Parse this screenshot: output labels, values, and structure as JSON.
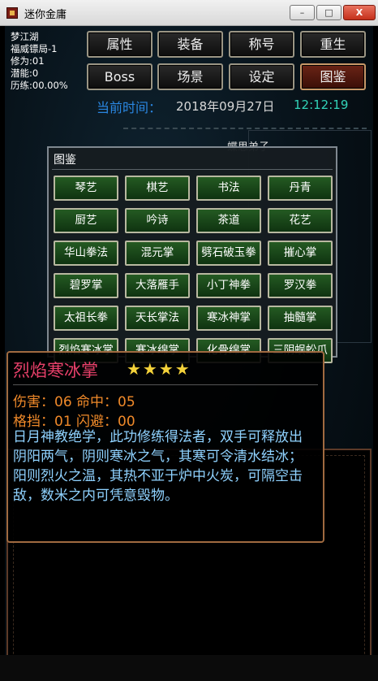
{
  "window": {
    "title": "迷你金庸",
    "min": "–",
    "max": "□",
    "close": "X"
  },
  "player": {
    "name": "梦江湖",
    "location": "福威镖局-1",
    "cultivation": "修为:01",
    "potential": "潜能:0",
    "experience": "历练:00.00%"
  },
  "menu": [
    "属性",
    "装备",
    "称号",
    "重生",
    "Boss",
    "场景",
    "设定",
    "图鉴"
  ],
  "time": {
    "label": "当前时间：",
    "date": "2018年09月27日",
    "clock": "12:12:19"
  },
  "background_text": "蝶思弟子",
  "atlas": {
    "title": "图鉴",
    "skills": [
      "琴艺",
      "棋艺",
      "书法",
      "丹青",
      "厨艺",
      "吟诗",
      "茶道",
      "花艺",
      "华山拳法",
      "混元掌",
      "劈石破玉拳",
      "摧心掌",
      "碧罗掌",
      "大落雁手",
      "小丁神拳",
      "罗汉拳",
      "太祖长拳",
      "天长掌法",
      "寒冰神掌",
      "抽髓掌",
      "烈焰寒冰掌",
      "寒冰绵掌",
      "化骨绵掌",
      "三阴蜈蚣爪"
    ]
  },
  "detail": {
    "name": "烈焰寒冰掌",
    "stars": "★★★★",
    "rating": 4,
    "damage_label": "伤害：",
    "damage": "06",
    "hit_label": "命中：",
    "hit": "05",
    "block_label": "格挡：",
    "block": "01",
    "dodge_label": "闪避：",
    "dodge": "00",
    "description": "日月神教绝学，此功修练得法者，双手可释放出阴阳两气，阴则寒冰之气，其寒可令清水结冰；阳则烈火之温，其热不亚于炉中火炭，可隔空击敌，数米之内可凭意毁物。"
  },
  "colors": {
    "accent_red": "#e8406a",
    "stat_orange": "#f08a2a",
    "desc_blue": "#8fd2ff",
    "time_blue": "#2a86e0",
    "clock_teal": "#32d2b8",
    "star_gold": "#f4d23a"
  }
}
